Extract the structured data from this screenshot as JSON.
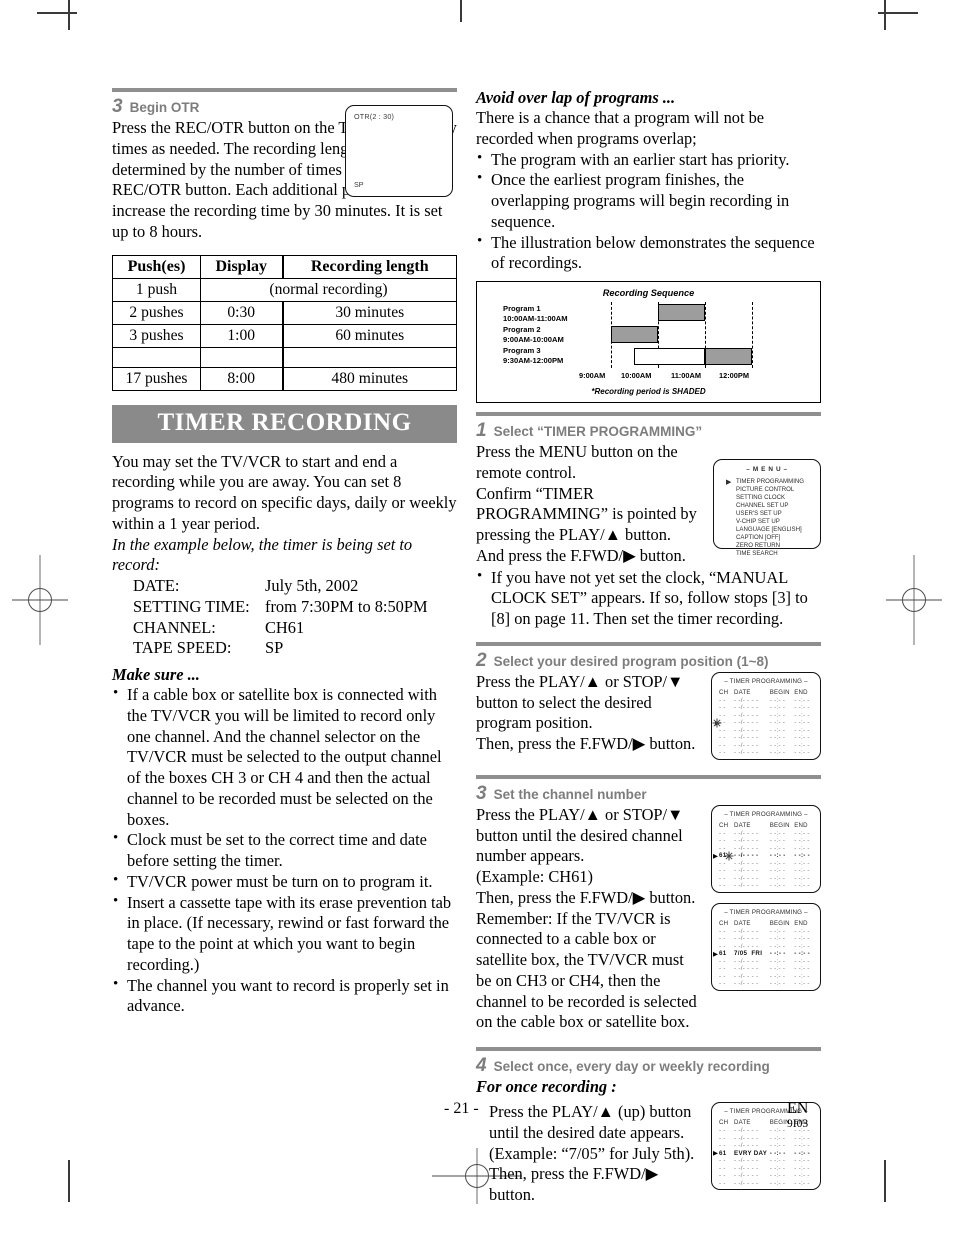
{
  "page": {
    "number_label": "- 21 -",
    "lang_code": "EN",
    "doc_code": "9I03"
  },
  "left_column": {
    "step3": {
      "number": "3",
      "title": "Begin OTR",
      "paragraph": "Press the REC/OTR button on the TV/VCR as many times as needed. The recording length will be determined by the number of times you press the REC/OTR button. Each additional push will increase the recording time by 30 minutes. It is set up to 8 hours.",
      "otr_screen": {
        "top_text": "OTR(2 : 30)",
        "bottom_text": "SP"
      }
    },
    "push_table": {
      "headers": [
        "Push(es)",
        "Display",
        "Recording length"
      ],
      "rows": [
        {
          "pushes": "1 push",
          "display": "",
          "length": "(normal recording)",
          "merged": true
        },
        {
          "pushes": "2 pushes",
          "display": "0:30",
          "length": "30 minutes",
          "merged": false
        },
        {
          "pushes": "3 pushes",
          "display": "1:00",
          "length": "60 minutes",
          "merged": false
        },
        {
          "pushes": "",
          "display": "",
          "length": "",
          "merged": false
        },
        {
          "pushes": "17 pushes",
          "display": "8:00",
          "length": "480 minutes",
          "merged": false
        }
      ]
    },
    "banner_title": "TIMER RECORDING",
    "intro_paragraph": "You may set the TV/VCR to start and end a recording while you are away. You can set 8 programs to record on specific days, daily or weekly within a 1 year period.",
    "example_lead": "In the example below, the timer is being set to record:",
    "example": [
      {
        "key": "DATE:",
        "value": "July 5th, 2002"
      },
      {
        "key": "SETTING TIME:",
        "value": "from 7:30PM to 8:50PM"
      },
      {
        "key": "CHANNEL:",
        "value": "CH61"
      },
      {
        "key": "TAPE SPEED:",
        "value": "SP"
      }
    ],
    "make_sure_heading": "Make sure ...",
    "make_sure_items": [
      "If a cable box or satellite box is connected with the TV/VCR you will be limited to record only one channel.  And the channel selector on the TV/VCR must be selected to the output channel of the boxes CH 3 or CH 4 and then the actual channel to be recorded must be selected on the boxes.",
      "Clock must be set to the correct time and date before setting the timer.",
      "TV/VCR power must be turn on to program it.",
      "Insert a cassette tape with its erase prevention tab in place. (If necessary, rewind or fast forward the tape to the point at which you want to begin recording.)",
      "The channel you want to record is properly set in advance."
    ]
  },
  "right_column": {
    "avoid_heading": "Avoid over lap of programs ...",
    "avoid_paragraph": "There is a chance that a program will not be recorded when programs overlap;",
    "avoid_items": [
      "The program with an earlier start has priority.",
      "Once the earliest program finishes, the overlapping programs will begin recording in sequence.",
      "The illustration below demonstrates the sequence of recordings."
    ],
    "sequence_figure": {
      "title": "Recording Sequence",
      "footnote": "*Recording period is SHADED",
      "programs": [
        {
          "name": "Program 1",
          "time": "10:00AM-11:00AM"
        },
        {
          "name": "Program 2",
          "time": "9:00AM-10:00AM"
        },
        {
          "name": "Program 3",
          "time": "9:30AM-12:00PM"
        }
      ],
      "axis_ticks": [
        "9:00AM",
        "10:00AM",
        "11:00AM",
        "12:00PM"
      ]
    },
    "step1": {
      "number": "1",
      "title": "Select “TIMER PROGRAMMING”",
      "paragraph": "Press the MENU button on the remote control.\nConfirm “TIMER PROGRAMMING” is pointed by pressing the PLAY/▲ button.\nAnd press the F.FWD/▶ button.",
      "note": "If you have not yet set the clock, “MANUAL CLOCK SET” appears. If so, follow stops [3] to [8] on page 11. Then set the timer recording.",
      "menu_screen": {
        "title": "– M E N U –",
        "items": [
          "TIMER PROGRAMMING",
          "PICTURE CONTROL",
          "SETTING CLOCK",
          "CHANNEL SET UP",
          "USER'S SET UP",
          "V-CHIP SET UP",
          "LANGUAGE  [ENGLISH]",
          "CAPTION  [OFF]",
          "ZERO RETURN",
          "TIME SEARCH"
        ],
        "pointer_index": 0
      }
    },
    "step2": {
      "number": "2",
      "title": "Select your desired program position (1~8)",
      "paragraph": "Press the PLAY/▲ or STOP/▼ button to select the desired program position.\nThen, press the F.FWD/▶ button.",
      "osd": {
        "title": "– TIMER PROGRAMMING –",
        "columns": [
          "CH",
          "DATE",
          "BEGIN",
          "END"
        ],
        "rows": [
          {
            "ch": "- -",
            "date": "- -/- -  - -",
            "begin": "- -:- -",
            "end": "- -:- -"
          },
          {
            "ch": "- -",
            "date": "- -/- -  - -",
            "begin": "- -:- -",
            "end": "- -:- -"
          },
          {
            "ch": "- -",
            "date": "- -/- -  - -",
            "begin": "- -:- -",
            "end": "- -:- -"
          },
          {
            "ch": "- -",
            "date": "- -/- -  - -",
            "begin": "- -:- -",
            "end": "- -:- -"
          },
          {
            "ch": "- -",
            "date": "- -/- -  - -",
            "begin": "- -:- -",
            "end": "- -:- -"
          },
          {
            "ch": "- -",
            "date": "- -/- -  - -",
            "begin": "- -:- -",
            "end": "- -:- -"
          },
          {
            "ch": "- -",
            "date": "- -/- -  - -",
            "begin": "- -:- -",
            "end": "- -:- -"
          },
          {
            "ch": "- -",
            "date": "- -/- -  - -",
            "begin": "- -:- -",
            "end": "- -:- -"
          }
        ],
        "cursor_row": 3
      }
    },
    "step3": {
      "number": "3",
      "title": "Set the channel number",
      "paragraph": "Press the PLAY/▲ or STOP/▼ button until the desired channel number appears.\n(Example: CH61)\nThen, press the F.FWD/▶ button.\nRemember: If the TV/VCR is connected to a cable box or satellite box, the TV/VCR must be on CH3 or CH4, then the channel to be recorded is selected on the cable box or satellite box.",
      "osd_a": {
        "title": "– TIMER PROGRAMMING –",
        "columns": [
          "CH",
          "DATE",
          "BEGIN",
          "END"
        ],
        "cursor_row": 3,
        "active_ch": "61"
      },
      "osd_b": {
        "title": "– TIMER PROGRAMMING –",
        "columns": [
          "CH",
          "DATE",
          "BEGIN",
          "END"
        ],
        "cursor_row": 3,
        "active_ch": "61",
        "active_date": "7/05",
        "active_day": "FRI"
      }
    },
    "step4": {
      "number": "4",
      "title": "Select once, every day or weekly recording",
      "subheading": "For once recording :",
      "paragraph": "Press the PLAY/▲ (up) button until the desired date appears. (Example: “7/05” for July 5th). Then, press the F.FWD/▶ button.",
      "osd": {
        "title": "– TIMER PROGRAMMING –",
        "columns": [
          "CH",
          "DATE",
          "BEGIN",
          "END"
        ],
        "cursor_row": 3,
        "active_ch": "61",
        "active_date": "EVRY DAY"
      }
    }
  },
  "colors": {
    "banner_bg": "#8a8a8a",
    "step_label": "#7d7d7d",
    "shaded_bar": "#9d9d9d"
  }
}
